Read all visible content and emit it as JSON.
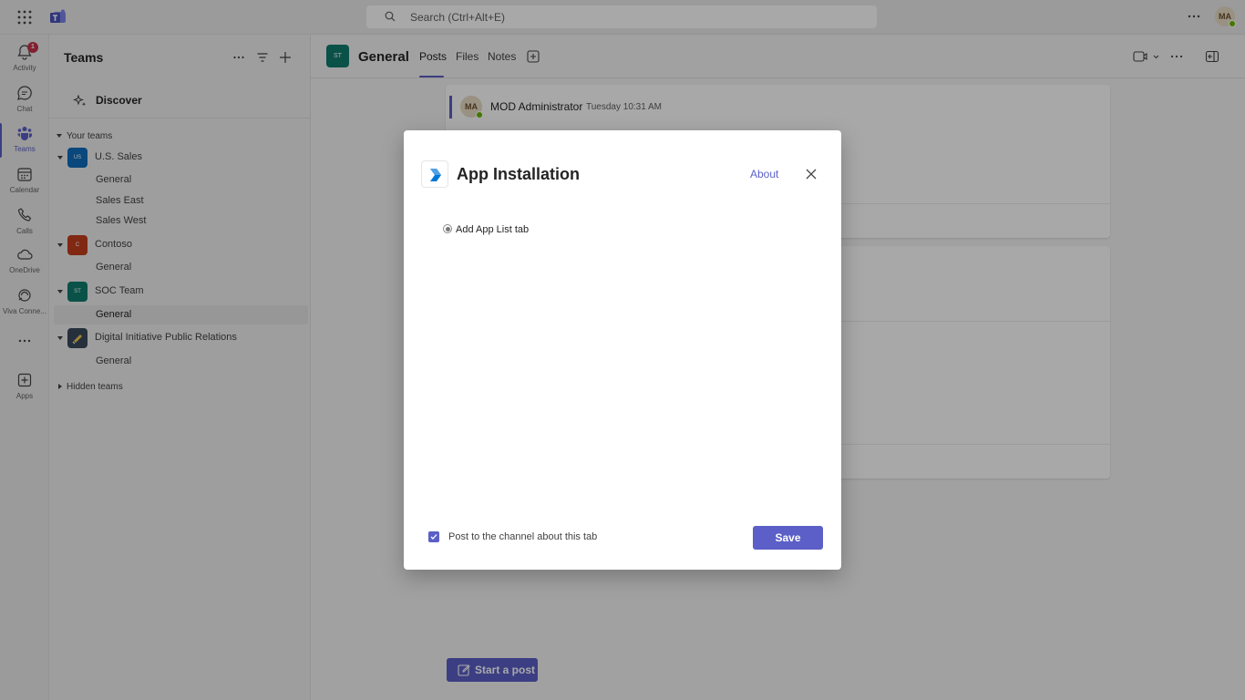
{
  "topbar": {
    "search_placeholder": "Search (Ctrl+Alt+E)",
    "user_initials": "MA"
  },
  "rail": {
    "items": [
      {
        "label": "Activity",
        "icon": "bell-icon",
        "badge": "1"
      },
      {
        "label": "Chat",
        "icon": "chat-icon"
      },
      {
        "label": "Teams",
        "icon": "teams-icon"
      },
      {
        "label": "Calendar",
        "icon": "calendar-icon"
      },
      {
        "label": "Calls",
        "icon": "phone-icon"
      },
      {
        "label": "OneDrive",
        "icon": "cloud-icon"
      },
      {
        "label": "Viva Conne...",
        "icon": "viva-icon"
      },
      {
        "label": "Apps",
        "icon": "apps-add-icon"
      }
    ],
    "active": "Teams"
  },
  "panel": {
    "title": "Teams",
    "discover_label": "Discover",
    "your_teams_label": "Your teams",
    "hidden_teams_label": "Hidden teams",
    "teams": [
      {
        "name": "U.S. Sales",
        "initials": "US",
        "color": "#0f6cbd",
        "channels": [
          "General",
          "Sales East",
          "Sales West"
        ]
      },
      {
        "name": "Contoso",
        "initials": "C",
        "color": "#c43e1c",
        "channels": [
          "General"
        ]
      },
      {
        "name": "SOC Team",
        "initials": "ST",
        "color": "#107c6e",
        "channels": [
          "General"
        ]
      },
      {
        "name": "Digital Initiative Public Relations",
        "initials": "",
        "color": "#3b4a5c",
        "channels": [
          "General"
        ]
      }
    ],
    "selected_channel": "SOC Team / General"
  },
  "channel": {
    "avatar_initials": "ST",
    "name": "General",
    "tabs": [
      "Posts",
      "Files",
      "Notes"
    ],
    "active_tab": "Posts"
  },
  "posts": {
    "author": "MOD Administrator",
    "author_initials": "MA",
    "time": "Tuesday 10:31 AM",
    "start_post_label": "Start a post"
  },
  "dialog": {
    "title": "App Installation",
    "about_label": "About",
    "option_label": "Add App List tab",
    "checkbox_label": "Post to the channel about this tab",
    "checkbox_checked": true,
    "save_label": "Save"
  },
  "colors": {
    "accent": "#5b5fc7",
    "presence": "#6bb700",
    "badge": "#c4314b"
  }
}
